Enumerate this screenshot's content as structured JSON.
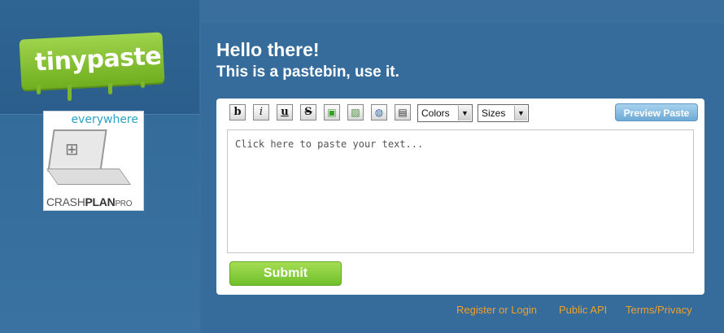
{
  "logo": {
    "text": "tinypaste"
  },
  "ad": {
    "tagline": "everywhere",
    "brand_prefix": "CRASH",
    "brand_bold": "PLAN",
    "brand_suffix": "PRO"
  },
  "header": {
    "greeting": "Hello there!",
    "subtitle": "This is a pastebin, use it."
  },
  "toolbar": {
    "bold_label": "b",
    "italic_label": "i",
    "underline_label": "u",
    "strike_label": "S",
    "colors_select": "Colors",
    "sizes_select": "Sizes",
    "preview_label": "Preview Paste",
    "icons": [
      "add-image-icon",
      "image-icon",
      "globe-link-icon",
      "film-icon"
    ]
  },
  "editor": {
    "placeholder": "Click here to paste your text..."
  },
  "submit_label": "Submit",
  "footer": {
    "register": "Register or Login",
    "api": "Public API",
    "terms": "Terms/Privacy"
  },
  "colors": {
    "accent_green": "#7dc431",
    "link_orange": "#f0a02a",
    "background_blue": "#3a6e9c"
  }
}
